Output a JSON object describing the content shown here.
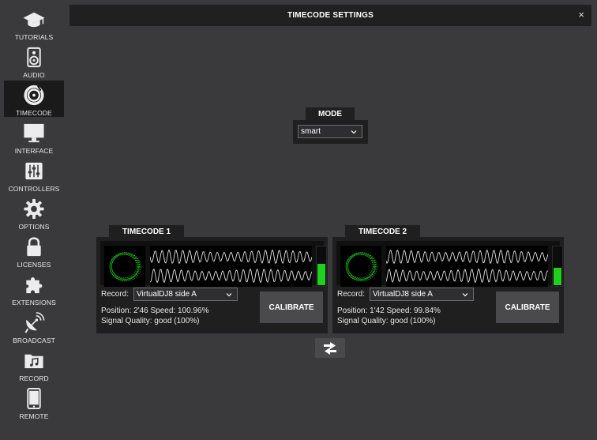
{
  "sidebar": {
    "items": [
      {
        "label": "TUTORIALS",
        "icon": "graduation-cap-icon"
      },
      {
        "label": "AUDIO",
        "icon": "speaker-icon"
      },
      {
        "label": "TIMECODE",
        "icon": "vinyl-icon"
      },
      {
        "label": "INTERFACE",
        "icon": "monitor-icon"
      },
      {
        "label": "CONTROLLERS",
        "icon": "mixer-icon"
      },
      {
        "label": "OPTIONS",
        "icon": "gear-icon"
      },
      {
        "label": "LICENSES",
        "icon": "lock-icon"
      },
      {
        "label": "EXTENSIONS",
        "icon": "puzzle-icon"
      },
      {
        "label": "BROADCAST",
        "icon": "broadcast-icon"
      },
      {
        "label": "RECORD",
        "icon": "music-folder-icon"
      },
      {
        "label": "REMOTE",
        "icon": "tablet-icon"
      }
    ],
    "active": "TIMECODE"
  },
  "window": {
    "title": "TIMECODE SETTINGS",
    "close_label": "×"
  },
  "mode": {
    "label": "MODE",
    "value": "smart"
  },
  "timecodes": [
    {
      "title": "TIMECODE 1",
      "record_label": "Record:",
      "record_value": "VirtualDJ8 side A",
      "position_speed": "Position: 2'46   Speed: 100.96%",
      "signal_quality": "Signal Quality: good (100%)",
      "calibrate_label": "CALIBRATE",
      "signal_level": 0.55
    },
    {
      "title": "TIMECODE 2",
      "record_label": "Record:",
      "record_value": "VirtualDJ8 side A",
      "position_speed": "Position: 1'42   Speed: 99.84%",
      "signal_quality": "Signal Quality: good (100%)",
      "calibrate_label": "CALIBRATE",
      "signal_level": 0.45
    }
  ],
  "colors": {
    "signal_green": "#1fd11f",
    "background": "#3a3a3c",
    "panel": "#1f1f20"
  }
}
